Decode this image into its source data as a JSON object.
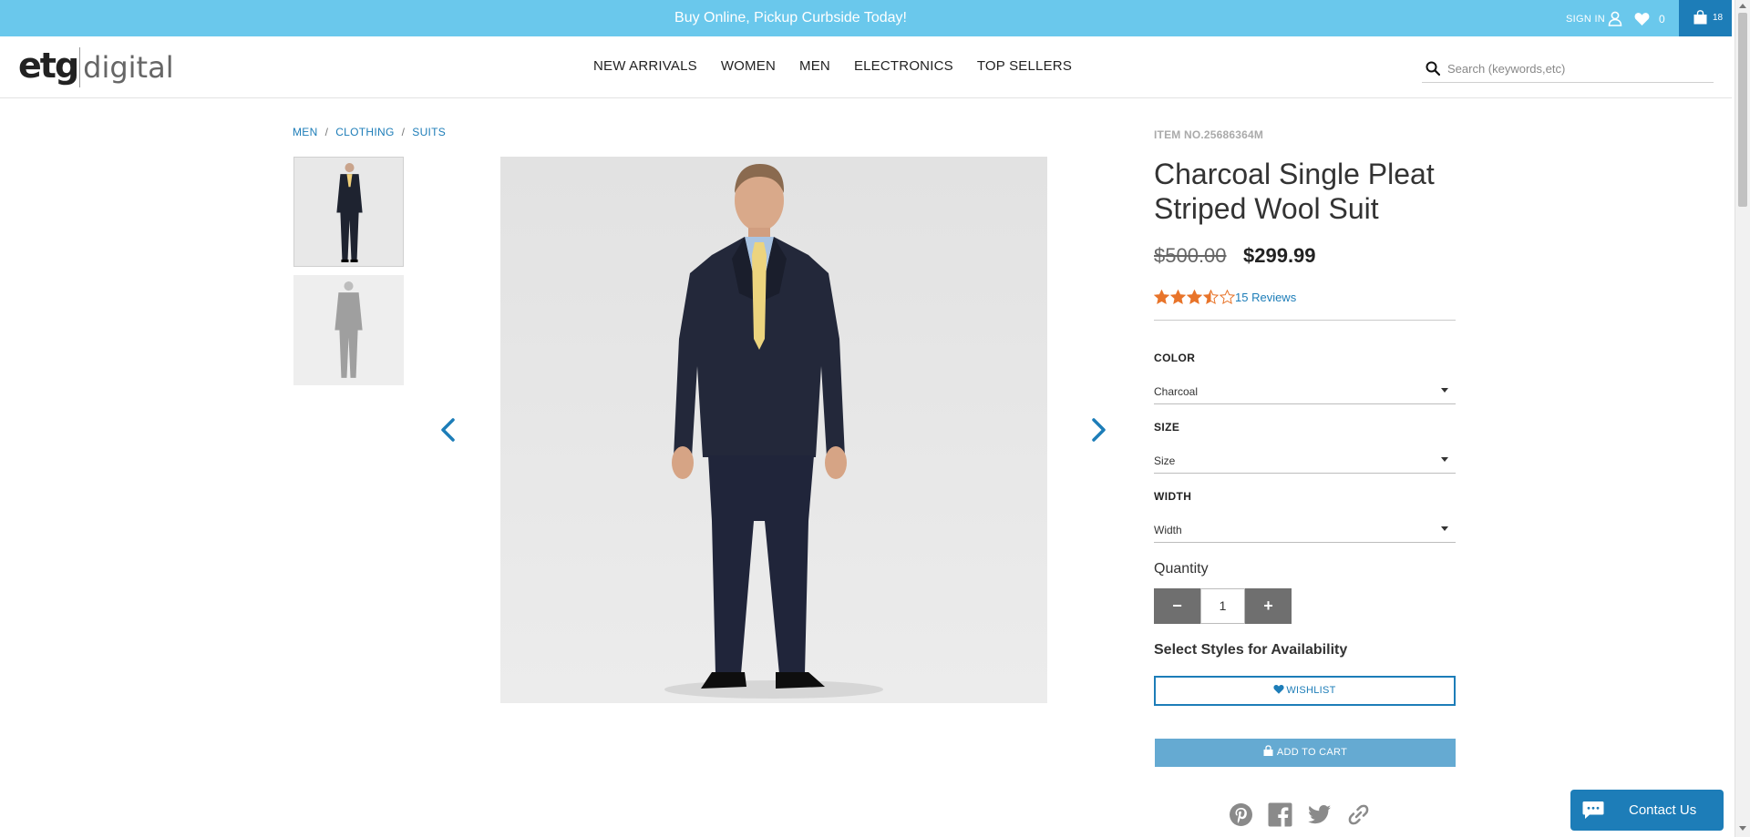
{
  "promo_bar": {
    "message": "Buy Online, Pickup Curbside Today!",
    "sign_in_label": "SIGN IN",
    "wishlist_count": "0",
    "cart_count": "18"
  },
  "header": {
    "logo_mark": "etg",
    "logo_text": "digital",
    "nav": [
      "NEW ARRIVALS",
      "WOMEN",
      "MEN",
      "ELECTRONICS",
      "TOP SELLERS"
    ],
    "search_placeholder": "Search (keywords,etc)"
  },
  "breadcrumb": [
    "MEN",
    "CLOTHING",
    "SUITS"
  ],
  "breadcrumb_separator": "/",
  "product": {
    "item_number": "ITEM NO.25686364M",
    "title": "Charcoal Single Pleat Striped Wool Suit",
    "original_price": "$500.00",
    "sale_price": "$299.99",
    "rating": 3.5,
    "rating_max": 5,
    "reviews_label": "15 Reviews",
    "options": [
      {
        "label": "COLOR",
        "value": "Charcoal"
      },
      {
        "label": "SIZE",
        "value": "Size"
      },
      {
        "label": "WIDTH",
        "value": "Width"
      }
    ],
    "quantity_label": "Quantity",
    "quantity_value": "1",
    "quantity_minus": "−",
    "quantity_plus": "+",
    "availability_text": "Select Styles for Availability",
    "wishlist_label": "WISHLIST",
    "add_to_cart_label": "ADD TO CART"
  },
  "social_icons": [
    "pinterest-icon",
    "facebook-icon",
    "twitter-icon",
    "link-icon"
  ],
  "chat": {
    "label": "Contact Us"
  },
  "colors": {
    "promo_bar": "#6ac8ec",
    "brand_blue": "#1d7db8",
    "add_to_cart": "#65aad2",
    "star": "#e8742a",
    "qty_button": "#6f6f6f"
  }
}
